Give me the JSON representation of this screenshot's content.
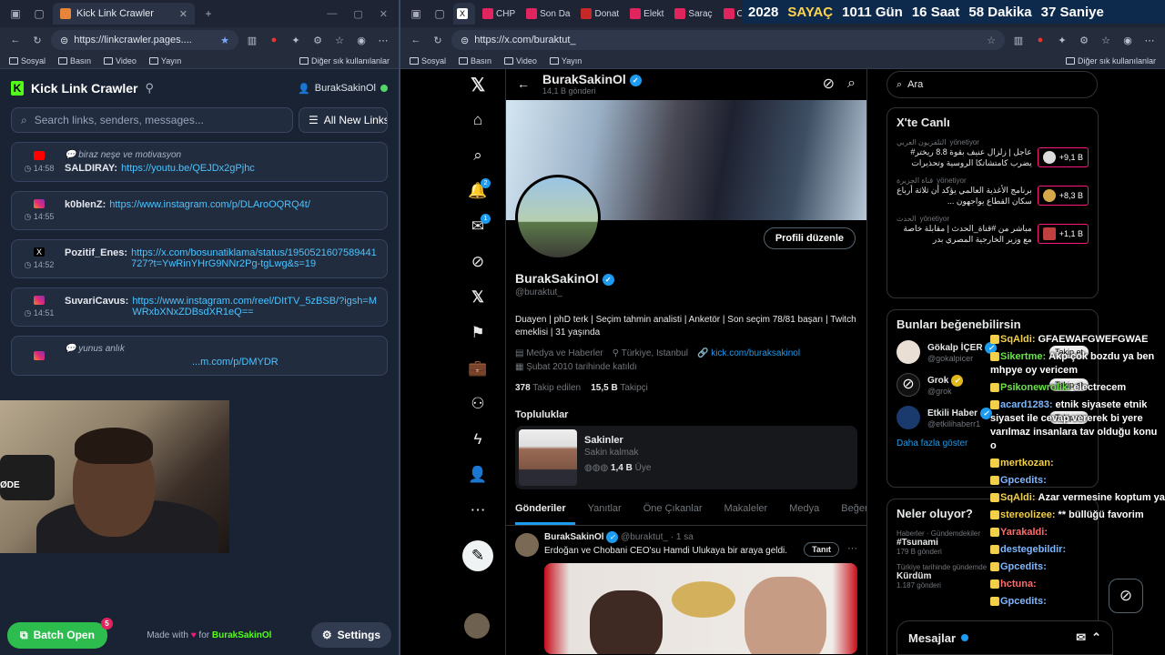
{
  "left_browser": {
    "tab_title": "Kick Link Crawler",
    "url": "https://linkcrawler.pages....",
    "bookmarks": [
      "Sosyal",
      "Basın",
      "Video",
      "Yayın"
    ],
    "other_bookmarks": "Diğer sık kullanılanlar"
  },
  "app": {
    "title": "Kick Link Crawler",
    "user": "BurakSakinOl",
    "search_placeholder": "Search links, senders, messages...",
    "filter": "All New Links",
    "messages": [
      {
        "note": "biraz neşe ve motivasyon",
        "time": "14:58",
        "sender": "SALDIRAY:",
        "link": "https://youtu.be/QEJDx2gPjhc",
        "platform": "youtube"
      },
      {
        "note": "",
        "time": "14:55",
        "sender": "k0blenZ:",
        "link": "https://www.instagram.com/p/DLAroOQRQ4t/",
        "platform": "instagram"
      },
      {
        "note": "",
        "time": "14:52",
        "sender": "Pozitif_Enes:",
        "link": "https://x.com/bosunatiklama/status/1950521607589441727?t=YwRinYHrG9NNr2Pg-tgLwg&s=19",
        "platform": "x"
      },
      {
        "note": "",
        "time": "14:51",
        "sender": "SuvariCavus:",
        "link": "https://www.instagram.com/reel/DItTV_5zBSB/?igsh=MWRxbXNxZDBsdXR1eQ==",
        "platform": "instagram"
      },
      {
        "note": "yunus anlık",
        "time": "",
        "sender": "",
        "link": "...m.com/p/DMYDR",
        "platform": "instagram"
      }
    ],
    "batch_label": "Batch Open",
    "batch_count": "5",
    "made_with_prefix": "Made with",
    "made_with_suffix": "for",
    "made_with_user": "BurakSakinOl",
    "settings_label": "Settings"
  },
  "cam": {
    "mic_text": "ØDE"
  },
  "right_browser": {
    "tabs": [
      "CHP",
      "Son Da",
      "Donat",
      "Elekt",
      "Saraç",
      "CHP"
    ],
    "url": "https://x.com/buraktut_",
    "bookmarks": [
      "Sosyal",
      "Basın",
      "Video",
      "Yayın"
    ],
    "other_bookmarks": "Diğer sık kullanılanlar"
  },
  "counter": {
    "year": "2028",
    "label": "SAYAÇ",
    "days": "1011 Gün",
    "hours": "16 Saat",
    "minutes": "58 Dakika",
    "seconds": "37 Saniye"
  },
  "profile": {
    "name": "BurakSakinOl",
    "posts": "14,1 B gönderi",
    "handle": "@buraktut_",
    "edit": "Profili düzenle",
    "bio": "Duayen | phD terk | Seçim tahmin analisti | Anketör | Son seçim 78/81 başarı | Twitch emeklisi | 31 yaşında",
    "category": "Medya ve Haberler",
    "location": "Türkiye, Istanbul",
    "link": "kick.com/buraksakinol",
    "joined": "Şubat 2010 tarihinde katıldı",
    "following_count": "378",
    "following_label": "Takip edilen",
    "followers_count": "15,5 B",
    "followers_label": "Takipçi",
    "communities_title": "Topluluklar",
    "community_name": "Sakinler",
    "community_sub": "Sakin kalmak",
    "community_members": "1,4 B",
    "community_members_label": "Üye",
    "tabs": [
      "Gönderiler",
      "Yanıtlar",
      "Öne Çıkanlar",
      "Makaleler",
      "Medya",
      "Beğeni"
    ],
    "tweet_name": "BurakSakinOl",
    "tweet_meta": "@buraktut_ · 1 sa",
    "tweet_text": "Erdoğan ve Chobani CEO'su Hamdi Ulukaya bir araya geldi.",
    "tweet_button": "Tanıt",
    "nav_badges": [
      "2",
      "1"
    ]
  },
  "sidebar": {
    "search_placeholder": "Ara",
    "live_title": "X'te Canlı",
    "live": [
      {
        "source": "التلفزيون العربي",
        "status": "yönetiyor",
        "text": "عاجل | زلزال عنيف بقوة 8.8 ريختر# يضرب كامتشاتكا الروسية وتحذيرات",
        "count": "+9,1 B"
      },
      {
        "source": "قناة الجزيرة",
        "status": "yönetiyor",
        "text": "برنامج الأغذية العالمي يؤكد أن ثلاثة أرباع سكان القطاع يواجهون ...",
        "count": "+8,3 B"
      },
      {
        "source": "الحدث",
        "status": "yönetiyor",
        "text": "مباشر من #قناة_الحدث | مقابلة خاصة مع وزير الخارجية المصري بدر",
        "count": "+1,1 B"
      }
    ],
    "suggest_title": "Bunları beğenebilirsin",
    "suggest": [
      {
        "name": "Gökalp İÇER",
        "handle": "@gokalpicer",
        "follow": "Takip et"
      },
      {
        "name": "Grok",
        "handle": "@grok",
        "follow": "Takip et"
      },
      {
        "name": "Etkili Haber",
        "handle": "@etkilihaberr1",
        "follow": "Takip et"
      }
    ],
    "show_more": "Daha fazla göster",
    "trends_title": "Neler oluyor?",
    "trends": [
      {
        "cat": "Haberler · Gündemdekiler",
        "tag": "#Tsunami",
        "count": "179 B gönderi"
      },
      {
        "cat": "Türkiye tarihinde gündemde",
        "tag": "Kürdüm",
        "count": "1.187 gönderi"
      }
    ],
    "messages_label": "Mesajlar"
  },
  "chat": [
    {
      "user": "SqAldi:",
      "color": "#f3d04a",
      "text": "GFAEWAFGWEFGWAE"
    },
    {
      "user": "Sikertme:",
      "color": "#6be24a",
      "text": "Akp çok bozdu ya ben mhpye oy vericem"
    },
    {
      "user": "Psikonewrolik:",
      "color": "#6be24a",
      "text": "electrecem"
    },
    {
      "user": "acard1283:",
      "color": "#7db7ff",
      "text": "etnik siyasete etnik siyaset ile cevap vererek bi yere varılmaz insanlara tav olduğu konu o"
    },
    {
      "user": "mertkozan:",
      "color": "#f3d04a",
      "text": ""
    },
    {
      "user": "Gpcedits:",
      "color": "#7db7ff",
      "text": ""
    },
    {
      "user": "SqAldi:",
      "color": "#f3d04a",
      "text": "Azar vermesine koptum ya"
    },
    {
      "user": "stereolizee:",
      "color": "#f3d04a",
      "text": "** büllüğü favorim"
    },
    {
      "user": "Yarakaldi:",
      "color": "#ff6b6b",
      "text": ""
    },
    {
      "user": "destegebildir:",
      "color": "#7db7ff",
      "text": ""
    },
    {
      "user": "Gpcedits:",
      "color": "#7db7ff",
      "text": ""
    },
    {
      "user": "hctuna:",
      "color": "#ff6b6b",
      "text": ""
    },
    {
      "user": "Gpcedits:",
      "color": "#7db7ff",
      "text": ""
    }
  ],
  "colors": {
    "kick_green": "#53fc18",
    "x_blue": "#1d9bf0",
    "live_pink": "#f91880"
  }
}
